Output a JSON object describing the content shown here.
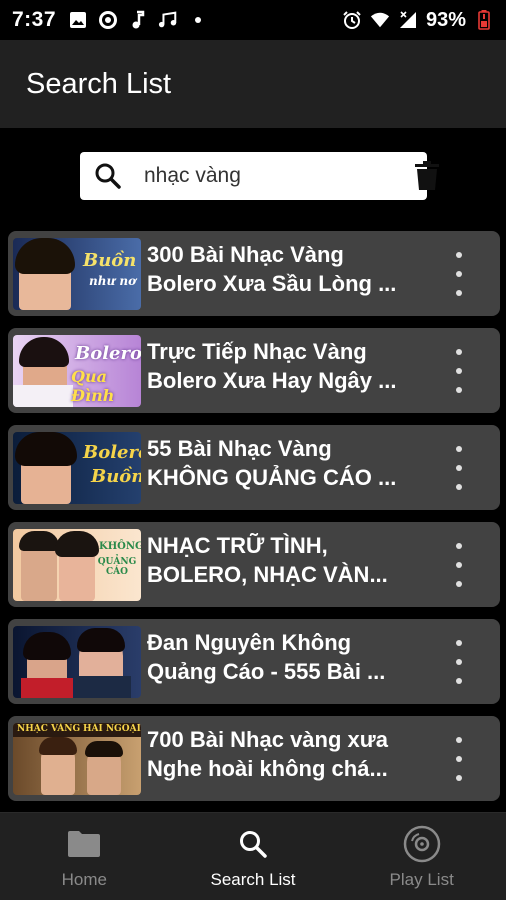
{
  "status_bar": {
    "time": "7:37",
    "battery_percent": "93%",
    "left_icons": [
      "image-icon",
      "target-icon",
      "music-note-icon",
      "music-notes-icon",
      "dot-icon"
    ],
    "right_icons": [
      "alarm-icon",
      "wifi-icon",
      "signal-icon",
      "battery-icon"
    ],
    "battery_color": "#e53935"
  },
  "app_bar": {
    "title": "Search List"
  },
  "search": {
    "value": "nhạc vàng",
    "placeholder": ""
  },
  "results": [
    {
      "line1": "300 Bài Nhạc Vàng",
      "line2": "Bolero Xưa Sầu Lòng ...",
      "thumb_text": "Buồn",
      "thumb_text2": "như nơ",
      "thumb_colors": [
        "#1a2a55",
        "#4a6ca8"
      ]
    },
    {
      "line1": "Trực Tiếp Nhạc Vàng",
      "line2": "Bolero Xưa Hay Ngây ...",
      "thumb_text": "Bolero",
      "thumb_text2": "Qua Đình",
      "thumb_colors": [
        "#b784d6",
        "#e9d4f3"
      ]
    },
    {
      "line1": "55 Bài Nhạc Vàng",
      "line2": "KHÔNG QUẢNG CÁO ...",
      "thumb_text": "Bolero",
      "thumb_text2": "Buồn",
      "thumb_colors": [
        "#0b1d3a",
        "#24406e"
      ]
    },
    {
      "line1": "NHẠC TRỮ TÌNH,",
      "line2": "BOLERO, NHẠC VÀN...",
      "thumb_text": "KHÔNG",
      "thumb_text2": "QUẢNG CÁO",
      "thumb_colors": [
        "#f2c9a0",
        "#fbe6cf"
      ]
    },
    {
      "line1": "Đan Nguyên Không",
      "line2": "Quảng Cáo - 555 Bài ...",
      "thumb_text": "",
      "thumb_text2": "",
      "thumb_colors": [
        "#0a1530",
        "#2a3d6a"
      ]
    },
    {
      "line1": "700 Bài Nhạc vàng xưa",
      "line2": "Nghe hoài không chá...",
      "thumb_text": "NHẠC VÀNG",
      "thumb_text2": "HẢI NGOẠI",
      "thumb_colors": [
        "#6b4a2a",
        "#c8a070"
      ]
    }
  ],
  "bottom_nav": {
    "items": [
      {
        "label": "Home",
        "icon": "folder-icon",
        "active": false
      },
      {
        "label": "Search List",
        "icon": "search-icon",
        "active": true
      },
      {
        "label": "Play List",
        "icon": "disc-icon",
        "active": false
      }
    ]
  }
}
